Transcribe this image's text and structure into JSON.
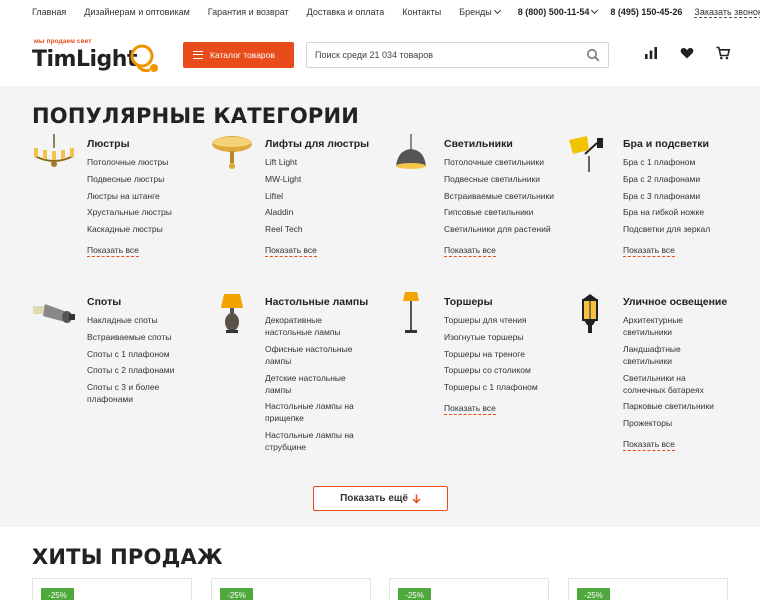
{
  "topbar": {
    "links": [
      "Главная",
      "Дизайнерам и оптовикам",
      "Гарантия и возврат",
      "Доставка и оплата",
      "Контакты"
    ],
    "brands": "Бренды",
    "phone1": "8 (800) 500-11-54",
    "phone2": "8 (495) 150-45-26",
    "callback": "Заказать звонок"
  },
  "header": {
    "logo_tagline": "мы продаем свет",
    "logo_name": "TimLight",
    "catalog_label": "Каталог товаров",
    "search_placeholder": "Поиск среди 21 034 товаров"
  },
  "popular": {
    "title": "ПОПУЛЯРНЫЕ КАТЕГОРИИ",
    "show_all": "Показать все",
    "categories": [
      {
        "title": "Люстры",
        "icon": "chandelier-icon",
        "links": [
          "Потолочные люстры",
          "Подвесные люстры",
          "Люстры на штанге",
          "Хрустальные люстры",
          "Каскадные люстры"
        ]
      },
      {
        "title": "Лифты для люстры",
        "icon": "ceiling-lift-icon",
        "links": [
          "Lift Light",
          "MW-Light",
          "Liftel",
          "Aladdin",
          "Reel Tech"
        ]
      },
      {
        "title": "Светильники",
        "icon": "pendant-lamp-icon",
        "links": [
          "Потолочные светильники",
          "Подвесные светильники",
          "Встраиваемые светильники",
          "Гипсовые светильники",
          "Светильники для растений"
        ]
      },
      {
        "title": "Бра и подсветки",
        "icon": "wall-sconce-icon",
        "links": [
          "Бра с 1 плафоном",
          "Бра с 2 плафонами",
          "Бра с 3 плафонами",
          "Бра на гибкой ножке",
          "Подсветки для зеркал"
        ]
      },
      {
        "title": "Споты",
        "icon": "spotlight-icon",
        "links": [
          "Накладные споты",
          "Встраиваемые споты",
          "Споты с 1 плафоном",
          "Споты с 2 плафонами",
          "Споты с 3 и более плафонами"
        ],
        "no_show_all": true
      },
      {
        "title": "Настольные лампы",
        "icon": "table-lamp-icon",
        "links": [
          "Декоративные настольные лампы",
          "Офисные настольные лампы",
          "Детские настольные лампы",
          "Настольные лампы на прищепке",
          "Настольные лампы на струбцине"
        ],
        "no_show_all": true
      },
      {
        "title": "Торшеры",
        "icon": "floor-lamp-icon",
        "links": [
          "Торшеры для чтения",
          "Изогнутые торшеры",
          "Торшеры на треноге",
          "Торшеры со столиком",
          "Торшеры с 1 плафоном"
        ]
      },
      {
        "title": "Уличное освещение",
        "icon": "street-lantern-icon",
        "links": [
          "Архитектурные светильники",
          "Ландшафтные светильники",
          "Светильники на солнечных батареях",
          "Парковые светильники",
          "Прожекторы"
        ]
      }
    ],
    "more_label": "Показать ещё"
  },
  "hits": {
    "title": "ХИТЫ ПРОДАЖ",
    "discounts": [
      "-25%",
      "-25%",
      "-25%",
      "-25%"
    ]
  },
  "colors": {
    "accent": "#e84c1a",
    "logo_orange": "#f29400",
    "badge_green": "#4fa83c",
    "section_bg": "#f4f4f4"
  }
}
